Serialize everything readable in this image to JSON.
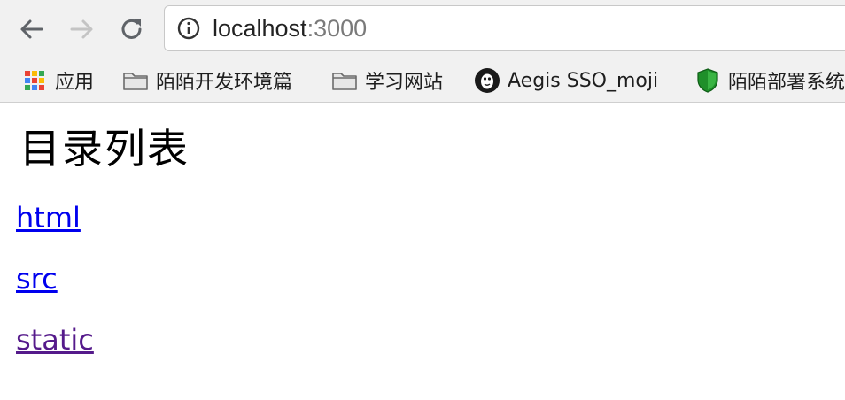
{
  "browser": {
    "url_host": "localhost",
    "url_port": ":3000",
    "bookmarks": [
      {
        "label": "应用",
        "icon": "apps-grid-icon"
      },
      {
        "label": "陌陌开发环境篇",
        "icon": "folder-icon"
      },
      {
        "label": "学习网站",
        "icon": "folder-icon"
      },
      {
        "label": "Aegis SSO_moji",
        "icon": "aegis-logo-icon"
      },
      {
        "label": "陌陌部署系统",
        "icon": "green-shield-icon"
      }
    ]
  },
  "page": {
    "title": "目录列表",
    "links": [
      {
        "label": "html",
        "visited": false
      },
      {
        "label": "src",
        "visited": false
      },
      {
        "label": "static",
        "visited": true
      }
    ]
  },
  "colors": {
    "link": "#0000ee",
    "visited_link": "#551a8b",
    "chrome_bg": "#f1f1f1"
  }
}
